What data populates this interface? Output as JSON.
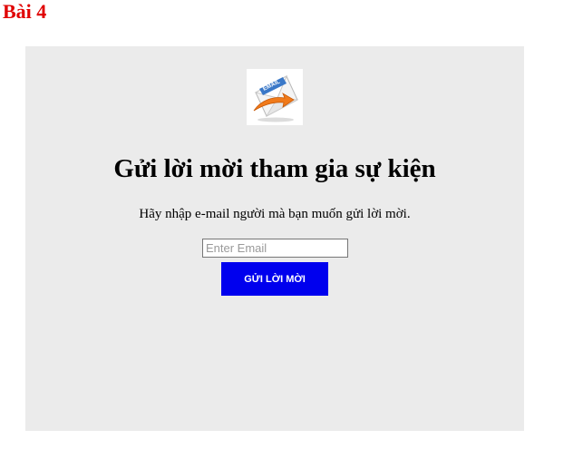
{
  "page": {
    "heading": "Bài 4"
  },
  "invite": {
    "logo": {
      "icon": "email-envelope-icon",
      "text": "EMAIL"
    },
    "title": "Gửi lời mời tham gia sự kiện",
    "description": "Hãy nhập e-mail người mà bạn muốn gửi lời mời.",
    "email_input": {
      "value": "",
      "placeholder": "Enter Email"
    },
    "submit_label": "GỬI LỜI MỜI"
  },
  "colors": {
    "heading": "#e00000",
    "card_background": "#ebebeb",
    "button_background": "#0000ee",
    "button_text": "#ffffff"
  }
}
